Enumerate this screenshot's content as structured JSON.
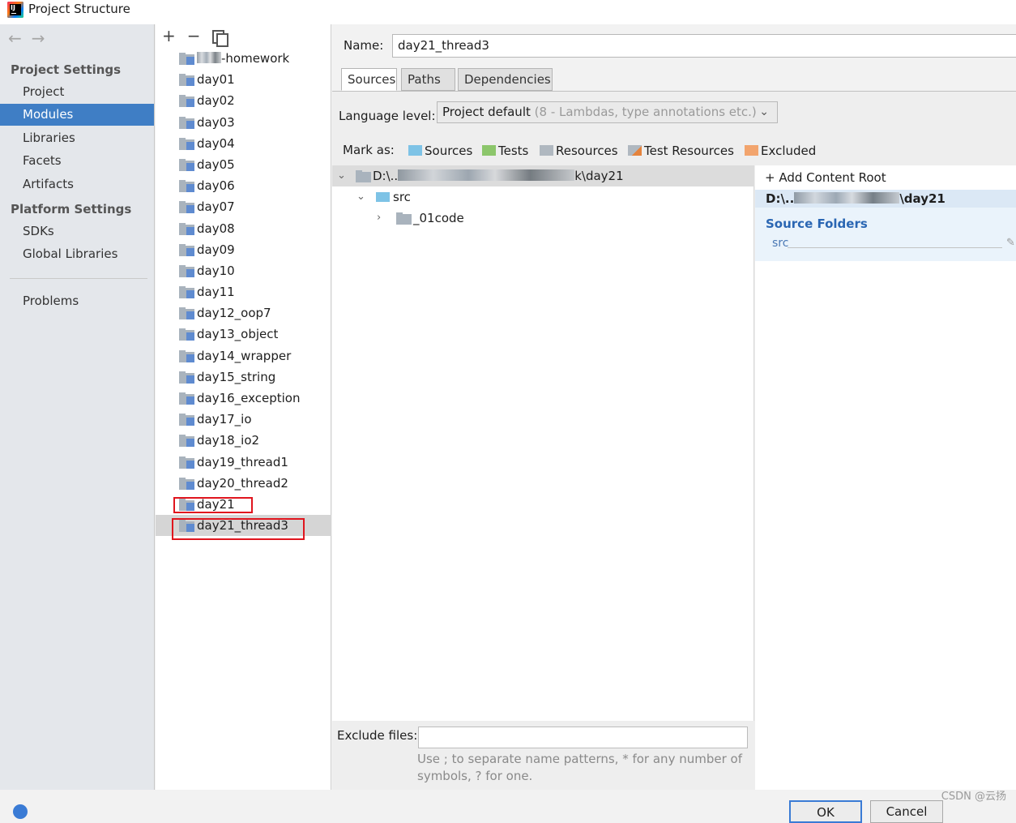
{
  "window": {
    "title": "Project Structure"
  },
  "nav": {
    "project_settings": "Project Settings",
    "items_project": [
      "Project",
      "Modules",
      "Libraries",
      "Facets",
      "Artifacts"
    ],
    "platform_settings": "Platform Settings",
    "items_platform": [
      "SDKs",
      "Global Libraries"
    ],
    "problems": "Problems",
    "selected": "Modules"
  },
  "modules": {
    "items": [
      "-homework",
      "day01",
      "day02",
      "day03",
      "day04",
      "day05",
      "day06",
      "day07",
      "day08",
      "day09",
      "day10",
      "day11",
      "day12_oop7",
      "day13_object",
      "day14_wrapper",
      "day15_string",
      "day16_exception",
      "day17_io",
      "day18_io2",
      "day19_thread1",
      "day20_thread2",
      "day21",
      "day21_thread3"
    ],
    "selected": "day21_thread3"
  },
  "detail": {
    "name_label": "Name:",
    "name_value": "day21_thread3",
    "tabs": [
      "Sources",
      "Paths",
      "Dependencies"
    ],
    "active_tab": "Sources",
    "language_label": "Language level:",
    "language_value": "Project default",
    "language_hint": "(8 - Lambdas, type annotations etc.)",
    "mark_as_label": "Mark as:",
    "mark_buttons": {
      "sources": "Sources",
      "tests": "Tests",
      "resources": "Resources",
      "test_resources": "Test Resources",
      "excluded": "Excluded"
    },
    "tree": {
      "root_prefix": "D:\\..",
      "root_suffix": "k\\day21",
      "src": "src",
      "child": "_01code"
    },
    "content_roots": {
      "add_label": "Add Content Root",
      "root_prefix": "D:\\..",
      "root_suffix": "\\day21",
      "source_folders_label": "Source Folders",
      "source_folder": "src"
    },
    "exclude_label": "Exclude files:",
    "exclude_value": "",
    "exclude_hint": "Use ; to separate name patterns, * for any number of symbols, ? for one."
  },
  "footer": {
    "ok": "OK",
    "cancel": "Cancel",
    "watermark": "CSDN @云扬"
  },
  "colors": {
    "selection": "#3f7ec5",
    "highlight_box": "#e0151e",
    "source_blue": "#2a66b3"
  }
}
